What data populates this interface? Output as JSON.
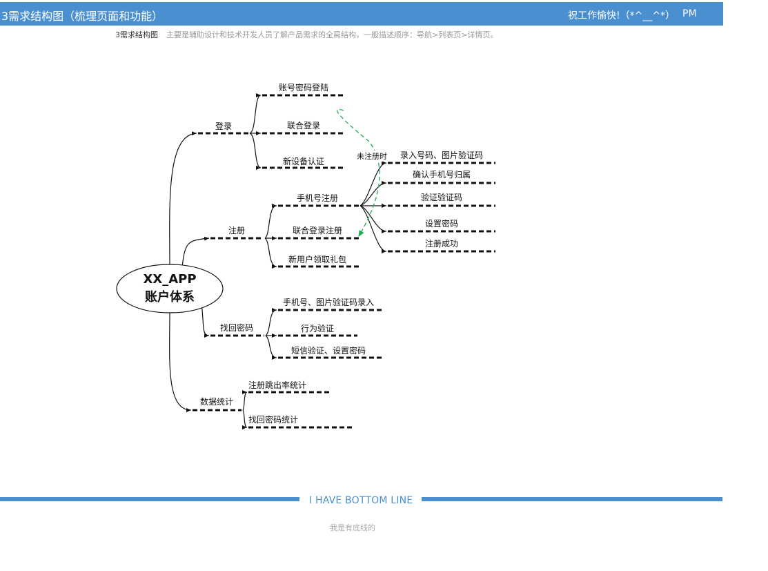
{
  "header": {
    "title": "3需求结构图（梳理页面和功能）",
    "greeting": "祝工作愉快!（*^__^*）",
    "user": "PM"
  },
  "subtitle": {
    "name": "3需求结构图",
    "description": "主要是辅助设计和技术开发人员了解产品需求的全局结构，一般描述顺序：导航>列表页>详情页。"
  },
  "diagram": {
    "center": {
      "line1": "XX_APP",
      "line2": "账户体系"
    },
    "branches": {
      "login": {
        "label": "登录",
        "children": [
          "账号密码登陆",
          "联合登录",
          "新设备认证"
        ]
      },
      "register": {
        "label": "注册",
        "children": [
          "手机号注册",
          "联合登录注册",
          "新用户领取礼包"
        ],
        "phone_steps": [
          "录入号码、图片验证码",
          "确认手机号归属",
          "验证验证码",
          "设置密码",
          "注册成功"
        ]
      },
      "recover": {
        "label": "找回密码",
        "children": [
          "手机号、图片验证码录入",
          "行为验证",
          "短信验证、设置密码"
        ]
      },
      "stats": {
        "label": "数据统计",
        "children": [
          "注册跳出率统计",
          "找回密码统计"
        ]
      }
    },
    "note": "未注册时",
    "colors": {
      "line": "#111111",
      "dashed_arrow": "#22aa55"
    }
  },
  "footer": {
    "title": "I HAVE BOTTOM LINE",
    "subtitle": "我是有底线的",
    "color": "#4a8fd0"
  }
}
